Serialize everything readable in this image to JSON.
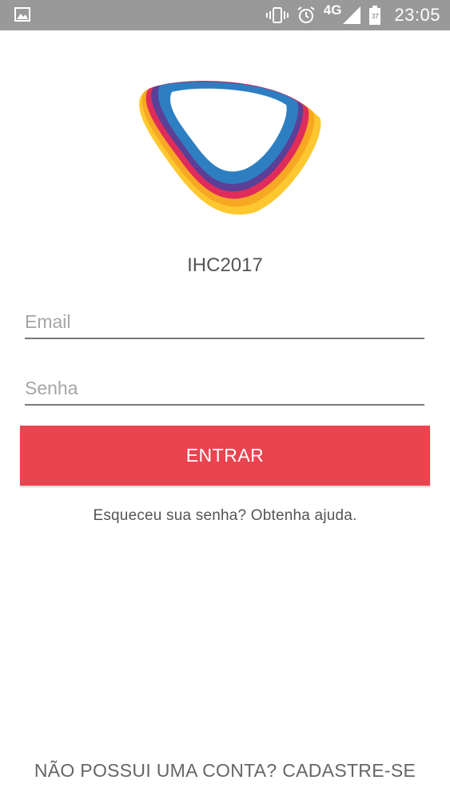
{
  "status_bar": {
    "network": "4G",
    "battery_level": "37",
    "time": "23:05",
    "icons": [
      "image-icon",
      "vibrate-icon",
      "alarm-icon",
      "signal-icon",
      "battery-icon"
    ]
  },
  "app": {
    "name": "IHC2017",
    "logo_colors": [
      "#2d7fc1",
      "#5c3f96",
      "#e02c5a",
      "#f7a823",
      "#fdc82f"
    ]
  },
  "form": {
    "email_placeholder": "Email",
    "password_placeholder": "Senha",
    "submit_label": "ENTRAR",
    "submit_color": "#e9444f",
    "forgot_text": "Esqueceu sua senha? Obtenha ajuda."
  },
  "footer": {
    "signup_text": "NÃO POSSUI UMA CONTA? CADASTRE-SE"
  }
}
